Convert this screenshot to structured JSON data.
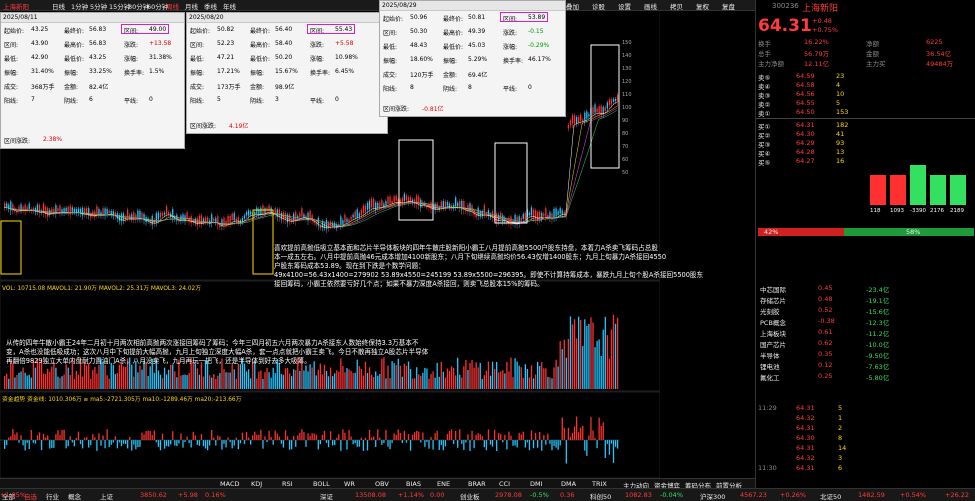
{
  "toolbar": {
    "left_label": "上海新阳",
    "tabs": [
      "日线",
      "1分钟",
      "5分钟",
      "15分钟",
      "30分钟",
      "60分钟",
      "周线",
      "月线",
      "季线",
      "年线"
    ],
    "right_items": [
      "分析",
      "叠加",
      "诊股",
      "设置",
      "画线",
      "拷贝",
      "复权",
      "复盘"
    ]
  },
  "popups": [
    {
      "date": "2025/08/11",
      "rows": [
        [
          "起始价:",
          "43.25",
          "最终价:",
          "56.83",
          "区间:",
          "49.00"
        ],
        [
          "区间:",
          "43.90",
          "最高价:",
          "56.83",
          "涨跌:",
          "+13.58"
        ],
        [
          "最低:",
          "42.90",
          "最低价:",
          "43.25",
          "涨幅:",
          "31.38%"
        ],
        [
          "振幅:",
          "31.40%",
          "振幅:",
          "33.25%",
          "换手率:",
          "1.5%"
        ],
        [
          "成交:",
          "368万手",
          "金额:",
          "82.4亿",
          "",
          "",
          ""
        ],
        [
          "阳线:",
          "7",
          "阴线:",
          "6",
          "平线:",
          "0"
        ]
      ],
      "extra": [
        "区间涨跌:",
        "2.38%"
      ]
    },
    {
      "date": "2025/08/20",
      "rows": [
        [
          "起始价:",
          "50.82",
          "最终价:",
          "56.40",
          "区间:",
          "55.43"
        ],
        [
          "区间:",
          "52.23",
          "最高价:",
          "58.40",
          "涨跌:",
          "+5.58"
        ],
        [
          "最低:",
          "47.21",
          "最低价:",
          "50.20",
          "涨幅:",
          "10.98%"
        ],
        [
          "振幅:",
          "17.21%",
          "振幅:",
          "15.67%",
          "换手率:",
          "6.45%"
        ],
        [
          "成交:",
          "173万手",
          "金额:",
          "98.9亿",
          "",
          "",
          ""
        ],
        [
          "阳线:",
          "5",
          "阴线:",
          "3",
          "平线:",
          "0"
        ]
      ],
      "extra": [
        "区间涨跌:",
        "4.19亿"
      ]
    },
    {
      "date": "2025/08/29",
      "rows": [
        [
          "起始价:",
          "50.96",
          "最终价:",
          "50.81",
          "区间:",
          "53.89"
        ],
        [
          "区间:",
          "50.30",
          "最高价:",
          "49.39",
          "涨跌:",
          "-0.15"
        ],
        [
          "最低:",
          "48.43",
          "最低价:",
          "45.03",
          "涨幅:",
          "-0.29%"
        ],
        [
          "振幅:",
          "18.60%",
          "振幅:",
          "5.29%",
          "换手率:",
          "46.17%"
        ],
        [
          "成交:",
          "120万手",
          "金额:",
          "69.4亿",
          "",
          "",
          ""
        ],
        [
          "阳线:",
          "8",
          "阴线:",
          "8",
          "平线:",
          "0"
        ]
      ],
      "extra": [
        "区间涨跌:",
        "-0.81亿"
      ]
    }
  ],
  "annotation": {
    "para1": [
      "喜欢提前高抛低吸立基本面和芯片半导体板块的四年牛散庄股新阳小霸王八月提前高抛5500户股东持盘，本着力A杀卖飞筹码占总股",
      "本一成五左右。八月中提前高抛46元成本增加4100新股东；八月下旬继续高抛均价56.43仅增1400股东；九月上旬暴力A杀接回4550",
      "户股东筹码成本53.89。现在到下跌是个数学问题：",
      "49x4100=56.43x1400=279902 53.89x4550=245199 53.89x5500=296395。即使不计算持筹成本，暴跌九月上旬个股A杀接回5500股东",
      "接回筹码，小霸王依然要亏好几个点；如果不暴力深度A杀接回，则卖飞总股本15%的筹码。"
    ],
    "para2": [
      "从传的四年牛散小霸王24年二月初十月两次相前高抛两次涨接回筹码了筹码；今年三四月初五六月两次暴力A杀接东人数始终保持3.3万基本不",
      "变，A杀也没能低吸成功；这次八月中下旬提前大幅高抛，九月上旬独立深度大幅A杀，套一点点就把小霸王卖飞。今日不散再独立A股芯片半导体",
      "再翻倍9829独立大单内盘耐力置油门A杀，八月没卖飞，九月再玩一把飞，还是半导体到好去多大吸筹。"
    ]
  },
  "indicators": {
    "vol": "VOL: 10715.08  MAVOL1: 21.90万  MAVOL2: 25.31万  MAVOL3: 24.02万",
    "fund": "资金趋势  资金线: 1010.306万  ≡ ma5:-2721.305万  ma10:-1289.46万  ma20:-213.66万",
    "labels": [
      "MACD",
      "KDJ",
      "RSI",
      "BOLL",
      "WR",
      "OBV",
      "BIAS",
      "ENE",
      "BRAR",
      "CCI",
      "DMI",
      "DMA",
      "TRIX",
      "主力动向",
      "资金博弈",
      "筹码分布",
      "前置分析"
    ]
  },
  "quote": {
    "code": "300236",
    "name": "上海新阳",
    "price": "64.31",
    "change": "+0.48",
    "pct": "+0.75%",
    "stats": [
      [
        "换手",
        "16.22%",
        "净额",
        "6225"
      ],
      [
        "总手",
        "56.79万",
        "金额",
        "36.54亿"
      ],
      [
        "主力净额",
        "12.11亿",
        "主力买",
        "49484万"
      ]
    ],
    "sell": [
      [
        "卖⑤",
        "64.59",
        "23"
      ],
      [
        "卖④",
        "64.58",
        "4"
      ],
      [
        "卖③",
        "64.56",
        "10"
      ],
      [
        "卖②",
        "64.55",
        "5"
      ],
      [
        "卖①",
        "64.50",
        "153"
      ]
    ],
    "buy": [
      [
        "买①",
        "64.31",
        "182"
      ],
      [
        "买②",
        "64.30",
        "41"
      ],
      [
        "买③",
        "64.29",
        "93"
      ],
      [
        "买④",
        "64.28",
        "13"
      ],
      [
        "买⑤",
        "64.27",
        "16"
      ]
    ],
    "buy_pct": "42%",
    "sell_pct": "58%",
    "bars": [
      "118",
      "1093",
      "-3390",
      "2176",
      "2189"
    ],
    "sectors": [
      [
        "中芯国际",
        "0.45",
        "-23.4亿"
      ],
      [
        "存储芯片",
        "0.48",
        "-19.1亿"
      ],
      [
        "光刻胶",
        "0.52",
        "-15.6亿"
      ],
      [
        "PCB概念",
        "-0.38",
        "-12.3亿"
      ],
      [
        "上海板块",
        "0.61",
        "-11.2亿"
      ],
      [
        "国产芯片",
        "0.62",
        "-10.0亿"
      ],
      [
        "半导体",
        "0.35",
        "-9.50亿"
      ],
      [
        "锂电池",
        "0.12",
        "-7.63亿"
      ],
      [
        "氟化工",
        "0.25",
        "-5.80亿"
      ]
    ],
    "ticks": [
      [
        "11:29",
        "64.31",
        "5"
      ],
      [
        "",
        "64.32",
        "1"
      ],
      [
        "",
        "64.31",
        "2"
      ],
      [
        "",
        "64.30",
        "8"
      ],
      [
        "",
        "64.31",
        "14"
      ],
      [
        "",
        "64.32",
        "3"
      ],
      [
        "11:30",
        "64.31",
        "6"
      ]
    ]
  },
  "bottom_tabs": [
    "全部",
    "自选",
    "行业",
    "概念",
    "地区",
    "指数",
    "板块",
    "龙虎榜",
    "资金博弈",
    "沪深京",
    "港股",
    "美股",
    "期货",
    "基金",
    "债券"
  ],
  "status": [
    [
      "上证",
      "3850.62",
      "+5.98",
      "0.16%"
    ],
    [
      "深证",
      "13508.08",
      "+1.14%",
      "0.00"
    ],
    [
      "创业板",
      "2978.08",
      "-0.5%",
      "0.36"
    ],
    [
      "科创50",
      "1082.83",
      "-0.04%"
    ],
    [
      "沪深300",
      "4567.23",
      "+0.26%"
    ],
    [
      "北证50",
      "1482.59",
      "+0.54%",
      "+26.22",
      "+1.85%"
    ]
  ]
}
